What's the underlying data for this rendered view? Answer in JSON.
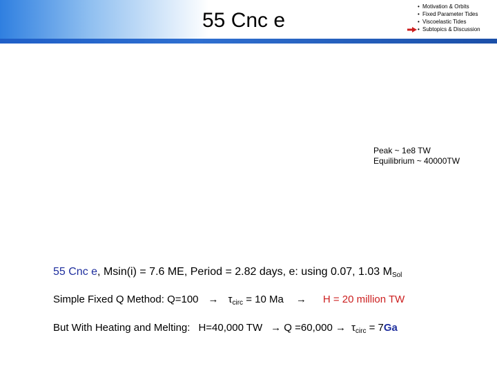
{
  "slide": {
    "title": "55 Cnc e",
    "agenda": [
      {
        "label": "Motivation & Orbits",
        "current": false
      },
      {
        "label": "Fixed Parameter Tides",
        "current": false
      },
      {
        "label": "Viscoelastic Tides",
        "current": false
      },
      {
        "label": "Subtopics & Discussion",
        "current": true
      }
    ],
    "bullet": "•",
    "note": {
      "line1": "Peak ~ 1e8 TW",
      "line2": "Equilibrium ~ 40000TW"
    },
    "line1": {
      "name": "55 Cnc e",
      "rest": ", Msin(i)  = 7.6 ME, Period = 2.82 days, e: using 0.07, 1.03 M",
      "sub": "Sol"
    },
    "line2": {
      "part1": "Simple Fixed Q Method: Q=100",
      "arrow1": "→",
      "tau": "τ",
      "sub": "circ",
      "part2": " = 10 Ma",
      "arrow2": "→",
      "result": "H = 20 million TW"
    },
    "line3": {
      "part1": "But With Heating and Melting:",
      "part2": "H=40,000 TW",
      "arrow1": "→",
      "part3": " Q =60,000 ",
      "arrow2": "→",
      "tau": "τ",
      "sub": "circ",
      "part4": " = 7",
      "unit": "Ga"
    },
    "colors": {
      "header_blue": "#2f7fe0",
      "rule_blue": "#1f5fc8",
      "name_blue": "#1f2f9e",
      "result_red": "#cc1f1f"
    }
  }
}
